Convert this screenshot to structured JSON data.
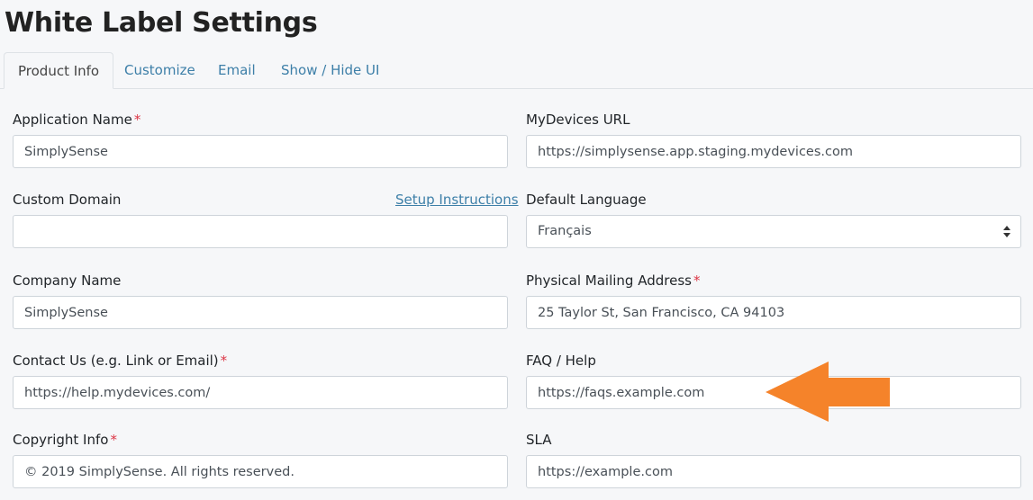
{
  "page": {
    "title": "White Label Settings"
  },
  "tabs": [
    {
      "label": "Product Info",
      "active": true
    },
    {
      "label": "Customize",
      "active": false
    },
    {
      "label": "Email",
      "active": false
    },
    {
      "label": "Show / Hide UI",
      "active": false
    }
  ],
  "required_marker": "*",
  "fields": {
    "application_name": {
      "label": "Application Name",
      "value": "SimplySense",
      "required": true
    },
    "mydevices_url": {
      "label": "MyDevices URL",
      "value": "https://simplysense.app.staging.mydevices.com"
    },
    "custom_domain": {
      "label": "Custom Domain",
      "value": "",
      "link": "Setup Instructions"
    },
    "default_language": {
      "label": "Default Language",
      "value": "Français"
    },
    "company_name": {
      "label": "Company Name",
      "value": "SimplySense"
    },
    "physical_mailing_address": {
      "label": "Physical Mailing Address",
      "value": "25 Taylor St, San Francisco, CA 94103",
      "required": true
    },
    "contact_us": {
      "label": "Contact Us (e.g. Link or Email)",
      "value": "https://help.mydevices.com/",
      "required": true
    },
    "faq_help": {
      "label": "FAQ / Help",
      "value": "https://faqs.example.com"
    },
    "copyright_info": {
      "label": "Copyright Info",
      "value": "© 2019 SimplySense. All rights reserved.",
      "required": true
    },
    "sla": {
      "label": "SLA",
      "value": "https://example.com"
    }
  },
  "colors": {
    "accent": "#3d7fa8",
    "required": "#dc3545",
    "annotation_arrow": "#f5832a",
    "background": "#f6f7f9"
  },
  "icons": {
    "select_arrows": "up-down-caret-icon",
    "annotation": "orange-left-arrow-icon"
  }
}
